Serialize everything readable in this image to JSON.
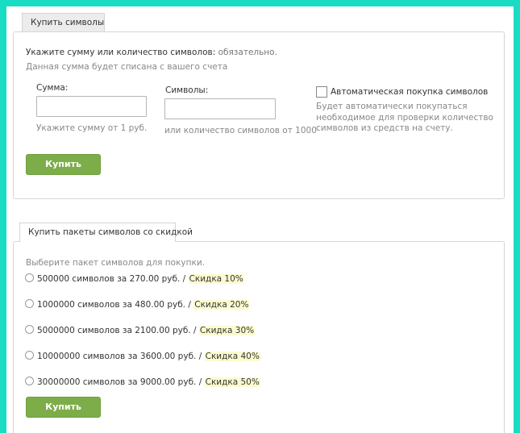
{
  "section1": {
    "tab_label": "Купить символы",
    "required_label": "Укажите сумму или количество символов:",
    "required_suffix": " обязательно.",
    "note": "Данная сумма будет списана с вашего счета",
    "sum": {
      "label": "Сумма:",
      "value": "",
      "hint": "Укажите сумму от 1 руб."
    },
    "symbols": {
      "label": "Символы:",
      "value": "",
      "hint": "или количество символов от 1000"
    },
    "auto_purchase": {
      "label": "Автоматическая покупка символов",
      "checked": false,
      "description": [
        "Будет автоматически покупаться",
        "необходимое для проверки количество",
        "символов из средств на счету."
      ]
    },
    "buy_label": "Купить"
  },
  "section2": {
    "tab_label": "Купить пакеты символов со скидкой",
    "prompt": "Выберите пакет символов для покупки.",
    "packages": [
      {
        "text": "500000 символов за 270.00 руб.",
        "separator": " / ",
        "discount": "Скидка 10%"
      },
      {
        "text": "1000000 символов за 480.00 руб.",
        "separator": " / ",
        "discount": "Скидка 20%"
      },
      {
        "text": "5000000 символов за 2100.00 руб.",
        "separator": " / ",
        "discount": "Скидка 30%"
      },
      {
        "text": "10000000 символов за 3600.00 руб.",
        "separator": " / ",
        "discount": "Скидка 40%"
      },
      {
        "text": "30000000 символов за 9000.00 руб.",
        "separator": " / ",
        "discount": "Скидка 50%"
      }
    ],
    "buy_label": "Купить"
  },
  "colors": {
    "frame": "#19dcc4",
    "button": "#7cad49",
    "discount_highlight": "#fcfbd0"
  }
}
